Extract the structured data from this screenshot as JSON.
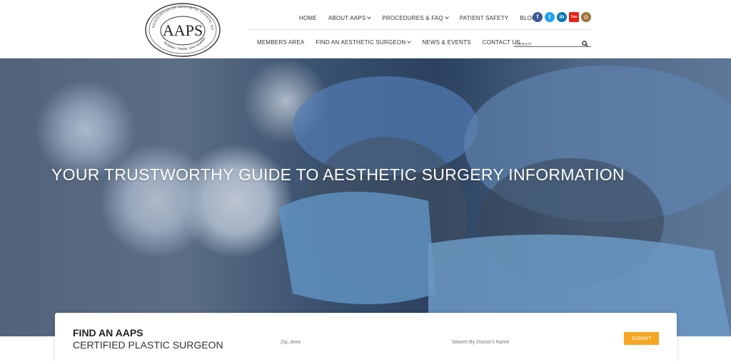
{
  "logo": {
    "top_text": "ASSOCIATION OF AESTHETIC PLASTIC SURGEONS",
    "initials": "AAPS",
    "bottom_text": "MUMBAI, THANE, NAVI MUMBAI"
  },
  "nav_top": [
    {
      "label": "HOME",
      "dropdown": false
    },
    {
      "label": "ABOUT AAPS",
      "dropdown": true
    },
    {
      "label": "PROCEDURES & FAQ",
      "dropdown": true
    },
    {
      "label": "PATIENT SAFETY",
      "dropdown": false
    },
    {
      "label": "BLOG",
      "dropdown": false
    }
  ],
  "nav_bottom": [
    {
      "label": "MEMBERS AREA",
      "dropdown": false
    },
    {
      "label": "FIND AN AESTHETIC SURGEON",
      "dropdown": true
    },
    {
      "label": "NEWS & EVENTS",
      "dropdown": false
    },
    {
      "label": "CONTACT US",
      "dropdown": false
    }
  ],
  "social": [
    {
      "name": "facebook-icon",
      "glyph": "f",
      "color": "#3b5998"
    },
    {
      "name": "twitter-icon",
      "glyph": "t",
      "color": "#1da1f2"
    },
    {
      "name": "linkedin-icon",
      "glyph": "in",
      "color": "#0077b5"
    },
    {
      "name": "youtube-icon",
      "glyph": "You",
      "color": "#e62117"
    },
    {
      "name": "instagram-icon",
      "glyph": "◎",
      "color": "#a0703a"
    }
  ],
  "search": {
    "placeholder": "Search"
  },
  "hero": {
    "title": "YOUR TRUSTWORTHY GUIDE TO AESTHETIC SURGERY INFORMATION"
  },
  "finder": {
    "title_line1": "FIND AN AAPS",
    "title_line2": "CERTIFIED PLASTIC SURGEON",
    "zip_placeholder": "Zip, Area",
    "doctor_placeholder": "Search By Doctor's Name",
    "submit_label": "SUBMIT"
  },
  "colors": {
    "accent": "#f5a623"
  }
}
